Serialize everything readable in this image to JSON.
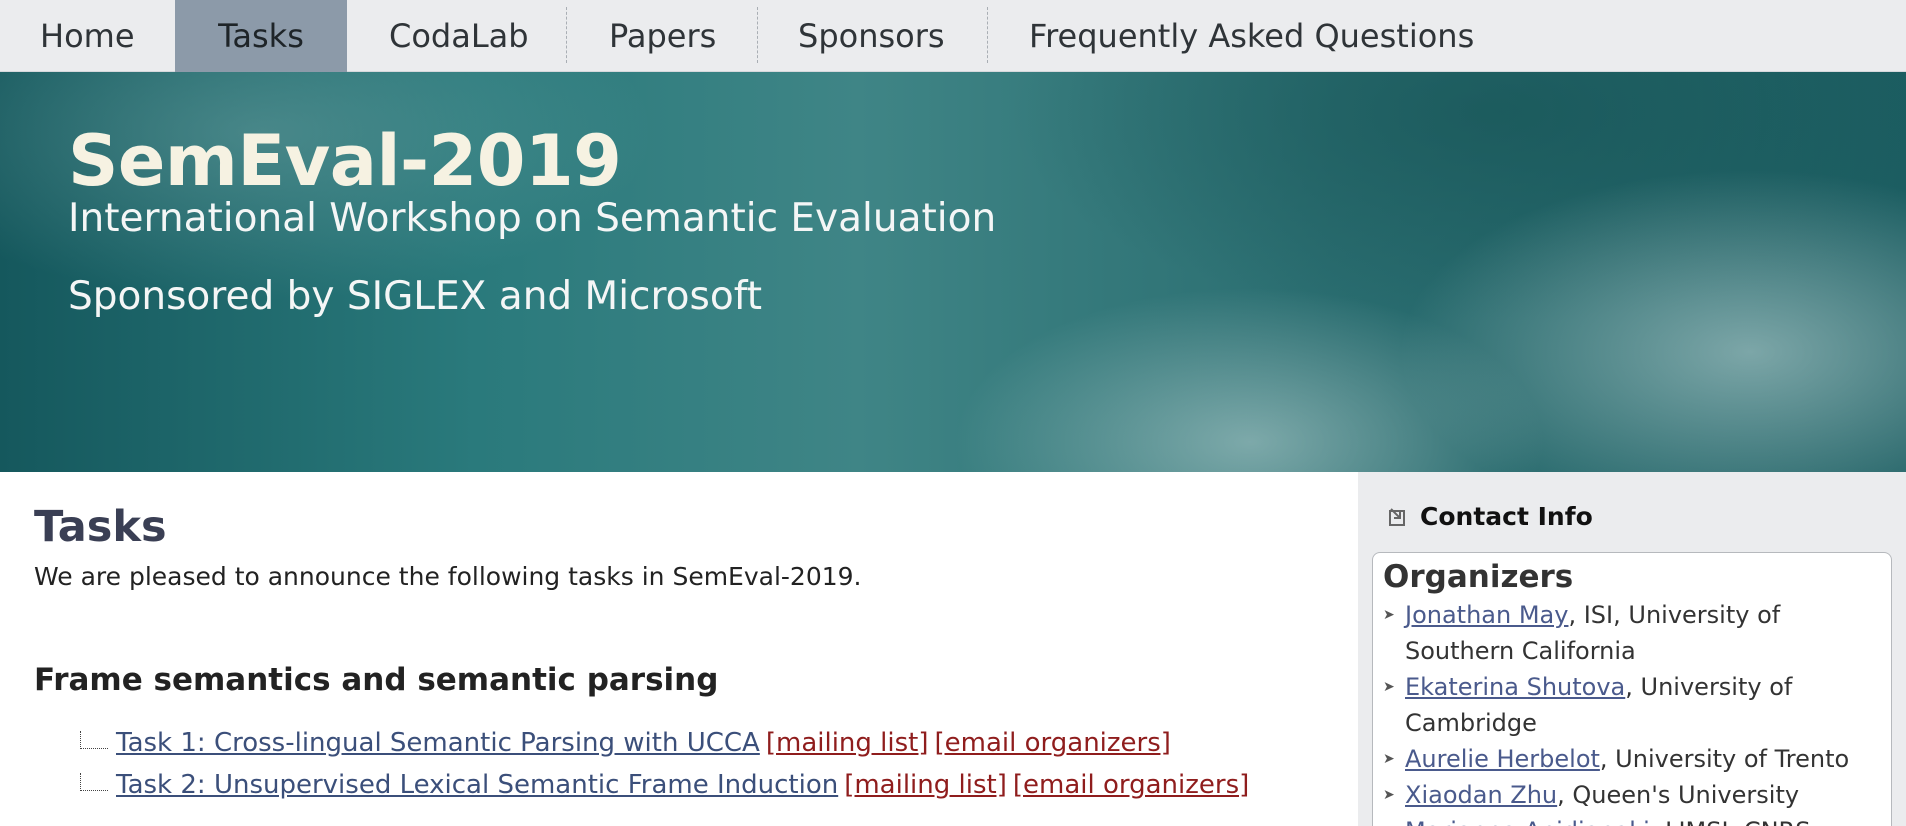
{
  "nav": {
    "items": [
      {
        "label": "Home"
      },
      {
        "label": "Tasks",
        "active": true
      },
      {
        "label": "CodaLab"
      },
      {
        "label": "Papers"
      },
      {
        "label": "Sponsors"
      },
      {
        "label": "Frequently Asked Questions"
      }
    ]
  },
  "banner": {
    "title": "SemEval-2019",
    "subtitle": "International Workshop on Semantic Evaluation",
    "sponsored": "Sponsored by SIGLEX and Microsoft"
  },
  "main": {
    "title": "Tasks",
    "intro": "We are pleased to announce the following tasks in SemEval-2019.",
    "section_title": "Frame semantics and semantic parsing",
    "tasks": [
      {
        "title": "Task 1: Cross-lingual Semantic Parsing with UCCA",
        "mailing": "[mailing list]",
        "email": "[email organizers]"
      },
      {
        "title": "Task 2: Unsupervised Lexical Semantic Frame Induction",
        "mailing": "[mailing list]",
        "email": "[email organizers]"
      }
    ]
  },
  "sidebar": {
    "contact_heading": "Contact Info",
    "organizers_title": "Organizers",
    "organizers": [
      {
        "name": "Jonathan May",
        "affiliation": ", ISI, University of Southern California"
      },
      {
        "name": "Ekaterina Shutova",
        "affiliation": ", University of Cambridge"
      },
      {
        "name": "Aurelie Herbelot",
        "affiliation": ", University of Trento"
      },
      {
        "name": "Xiaodan Zhu",
        "affiliation": ", Queen's University"
      },
      {
        "name": "Marianna Apidianaki",
        "affiliation": ", LIMSI, CNRS"
      }
    ]
  },
  "colors": {
    "nav_bg": "#ebecee",
    "nav_active": "#8c9aa9",
    "banner_teal": "#2a7a7c",
    "link_blue": "#3b4f7a",
    "link_red": "#8f1d1d"
  }
}
